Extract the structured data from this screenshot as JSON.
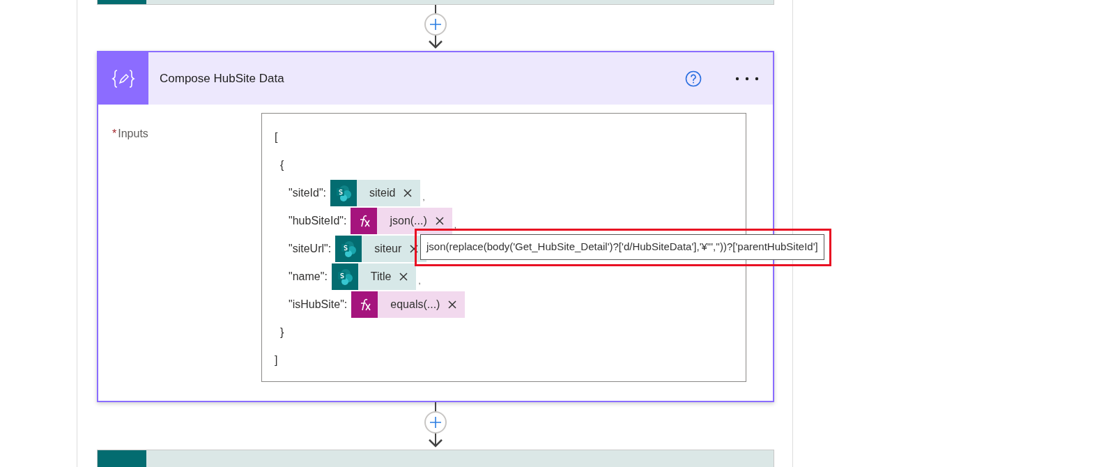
{
  "card": {
    "title": "Compose HubSite Data",
    "selected": true,
    "field": {
      "label": "Inputs",
      "required": true,
      "required_mark": "*",
      "value": {
        "open": "[",
        "close": "]",
        "children": [
          {
            "open": "{",
            "close": "}",
            "properties": [
              {
                "key": "\"siteId\":",
                "token": {
                  "kind": "dynamic",
                  "text": "siteid"
                },
                "separator": ","
              },
              {
                "key": "\"hubSiteId\":",
                "token": {
                  "kind": "expression",
                  "text": "json(...)"
                },
                "separator": ","
              },
              {
                "key": "\"siteUrl\":",
                "token": {
                  "kind": "dynamic",
                  "text": "siteur"
                }
              },
              {
                "key": "\"name\":",
                "token": {
                  "kind": "dynamic",
                  "text": "Title"
                },
                "separator": ","
              },
              {
                "key": "\"isHubSite\":",
                "token": {
                  "kind": "expression",
                  "text": "equals(...)"
                }
              }
            ]
          }
        ]
      }
    },
    "tooltip": {
      "text": "json(replace(body('Get_HubSite_Detail')?['d/HubSiteData'],'¥\"',''))?['parentHubSiteId']",
      "highlighted": true
    }
  }
}
